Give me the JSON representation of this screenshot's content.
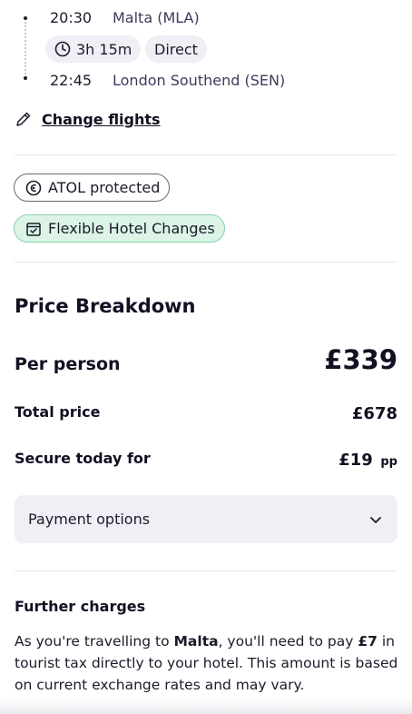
{
  "flight": {
    "depart_time": "20:30",
    "depart_airport": "Malta (MLA)",
    "duration": "3h 15m",
    "flight_type": "Direct",
    "arrive_time": "22:45",
    "arrive_airport": "London Southend (SEN)"
  },
  "change_flights_label": "Change flights",
  "badges": {
    "atol": "ATOL protected",
    "flexible": "Flexible Hotel Changes"
  },
  "price": {
    "heading": "Price Breakdown",
    "per_person_label": "Per person",
    "per_person_value": "£339",
    "total_label": "Total price",
    "total_value": "£678",
    "secure_label": "Secure today for",
    "secure_value": "£19",
    "secure_suffix": "pp"
  },
  "payment_options_label": "Payment options",
  "further": {
    "title": "Further charges",
    "text_1": "As you're travelling to ",
    "destination": "Malta",
    "text_2": ", you'll need to pay ",
    "amount": "£7",
    "text_3": " in tourist tax directly to your hotel. This amount is based on current exchange rates and may vary."
  },
  "colors": {
    "flex_badge_bg": "#dbf4e6",
    "flex_badge_border": "#8cd0ad",
    "panel_bg": "#efeff5"
  }
}
